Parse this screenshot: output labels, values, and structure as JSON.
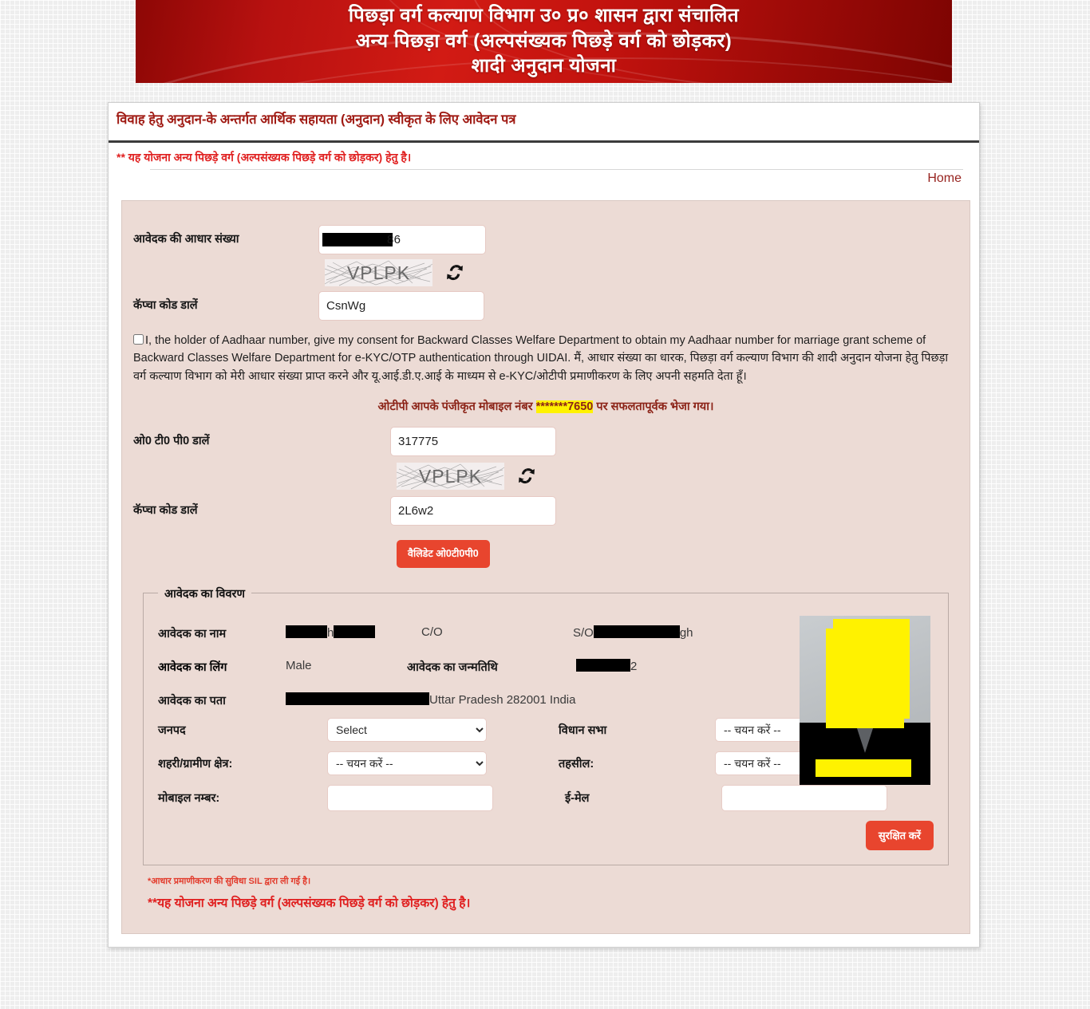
{
  "banner": {
    "line1": "पिछड़ा  वर्ग कल्याण विभाग उ० प्र० शासन द्वारा संचालित",
    "line2": "अन्य पिछड़ा वर्ग (अल्पसंख्यक पिछड़े वर्ग को छोड़कर)",
    "line3": "शादी अनुदान योजना"
  },
  "header": {
    "form_title": "विवाह हेतु अनुदान-के अन्तर्गत आर्थिक सहायता (अनुदान) स्वीकृत के लिए आवेदन पत्र",
    "notice": "** यह योजना अन्य पिछड़े वर्ग (अल्पसंख्यक पिछड़े वर्ग को छोड़कर) हेतु है।",
    "home_link": "Home"
  },
  "aadhaar_section": {
    "label": "आवेदक की आधार संख्या",
    "value_visible_tail": "86",
    "captcha_label": "कॅप्चा कोड डालें",
    "captcha_image_text": "VPLPK",
    "captcha_input_value": "CsnWg",
    "refresh_icon": "refresh-icon"
  },
  "consent": {
    "text": "I, the holder of Aadhaar number, give my consent for Backward Classes Welfare Department to obtain my Aadhaar number for marriage grant scheme of Backward Classes Welfare Department for e-KYC/OTP authentication through UIDAI. मैं, आधार संख्या का धारक, पिछड़ा वर्ग कल्याण विभाग की शादी अनुदान योजना हेतु पिछड़ा वर्ग कल्याण विभाग को मेरी आधार संख्या प्राप्त करने और यू.आई.डी.ए.आई के माध्यम से e-KYC/ओटीपी प्रमाणीकरण के लिए अपनी सहमति देता हूँ।",
    "checked": false
  },
  "otp_section": {
    "message_prefix": "ओटीपी आपके पंजीकृत मोबाइल नंबर ",
    "message_mask": "*******7650",
    "message_suffix": " पर सफलतापूर्वक भेजा गया।",
    "otp_label": "ओ0 टी0 पी0 डालें",
    "otp_value": "317775",
    "captcha_label": "कॅप्चा कोड डालें",
    "captcha_image_text": "VPLPK",
    "captcha_input_value": "2L6w2",
    "refresh_icon": "refresh-icon",
    "validate_button": "वैलिडेट ओ0टी0पी0"
  },
  "details": {
    "legend": "आवेदक का विवरण",
    "name_label": "आवेदक का नाम",
    "name_visible": "h",
    "co_label": "C/O",
    "so_prefix": "S/O",
    "so_visible_tail": "gh",
    "gender_label": "आवेदक का लिंग",
    "gender_value": "Male",
    "dob_label": "आवेदक का जन्मतिथि",
    "dob_visible_tail": "2",
    "address_label": "आवेदक का पता",
    "address_visible": "Uttar Pradesh 282001 India",
    "photo_alt": "applicant-photo"
  },
  "location_fields": {
    "district_label": "जनपद",
    "district_value": "Select",
    "assembly_label": "विधान सभा",
    "assembly_value": "-- चयन करें --",
    "area_label": "शहरी/ग्रामीण क्षेत्र:",
    "area_value": "-- चयन करें --",
    "tehsil_label": "तहसील:",
    "tehsil_value": "-- चयन करें --",
    "mobile_label": "मोबाइल नम्बर:",
    "mobile_value": "",
    "email_label": "ई-मेल",
    "email_value": "",
    "save_button": "सुरक्षित करें"
  },
  "footer": {
    "note_small": "*आधार प्रमाणीकरण की सुविधा SIL द्वारा ली गई है।",
    "note_bold": "**यह योजना अन्य पिछड़े वर्ग (अल्पसंख्यक पिछड़े वर्ग को छोड़कर) हेतु है।"
  },
  "colors": {
    "banner_red": "#c2120e",
    "accent_button": "#e8452e",
    "form_bg": "#ecdbd5",
    "notice_red": "#e02020",
    "title_red": "#a01b14",
    "highlight_yellow": "#fff200"
  }
}
